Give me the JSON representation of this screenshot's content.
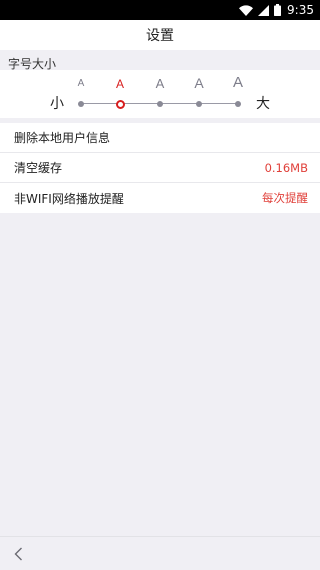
{
  "status_bar": {
    "time": "9:35",
    "icons": [
      "wifi-icon",
      "signal-icon",
      "battery-icon"
    ]
  },
  "header": {
    "title": "设置"
  },
  "font_size": {
    "label": "字号大小",
    "small_label": "小",
    "large_label": "大",
    "letters": [
      "A",
      "A",
      "A",
      "A",
      "A"
    ],
    "selected_index": 1
  },
  "settings": [
    {
      "label": "删除本地用户信息",
      "value": ""
    },
    {
      "label": "清空缓存",
      "value": "0.16MB"
    },
    {
      "label": "非WIFI网络播放提醒",
      "value": "每次提醒"
    }
  ],
  "footer": {
    "back_icon": "chevron-left-icon"
  },
  "colors": {
    "accent": "#d81e1e",
    "value_text": "#e0403a",
    "background": "#f0eff4"
  }
}
